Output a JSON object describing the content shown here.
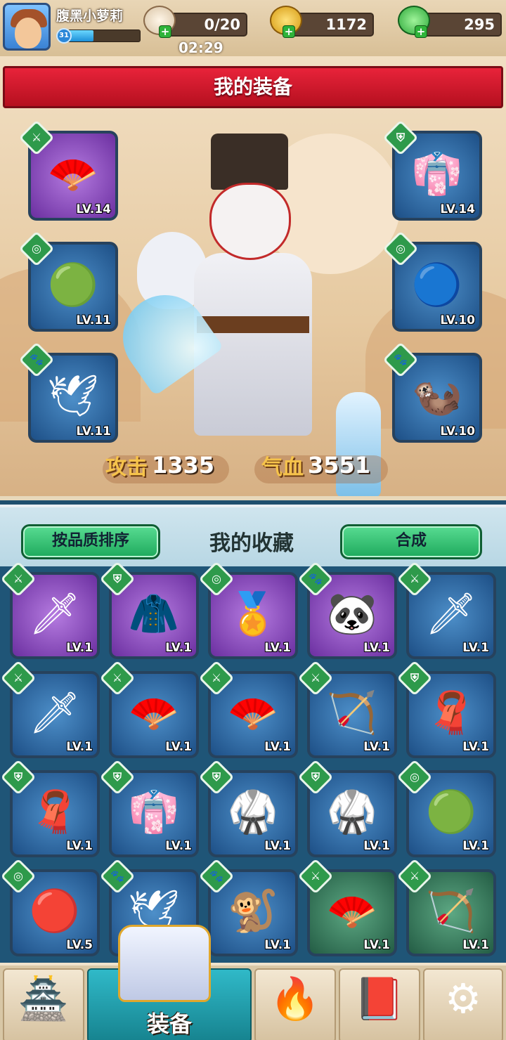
{
  "player": {
    "name": "腹黑小萝莉",
    "level": "31",
    "exp_fraction": 0.35
  },
  "resources": {
    "stamina": "0/20",
    "timer": "02:29",
    "gold": "1172",
    "jade": "295"
  },
  "equipment": {
    "title": "我的装备",
    "slots": [
      {
        "type": "weapon",
        "item": "fan",
        "level": "LV.14"
      },
      {
        "type": "armor",
        "item": "robe",
        "level": "LV.14"
      },
      {
        "type": "accessory",
        "item": "green-jade",
        "level": "LV.11"
      },
      {
        "type": "accessory",
        "item": "blue-jade",
        "level": "LV.10"
      },
      {
        "type": "pet",
        "item": "white-bird",
        "level": "LV.11"
      },
      {
        "type": "pet",
        "item": "ferret",
        "level": "LV.10"
      }
    ],
    "attack_label": "攻击",
    "attack_value": "1335",
    "hp_label": "气血",
    "hp_value": "3551"
  },
  "collection": {
    "sort_button": "按品质排序",
    "title": "我的收藏",
    "merge_button": "合成",
    "items": [
      {
        "type": "weapon",
        "rarity": "purple",
        "icon": "red-sword",
        "level": "LV.1"
      },
      {
        "type": "armor",
        "rarity": "purple",
        "icon": "fur-coat",
        "level": "LV.1"
      },
      {
        "type": "accessory",
        "rarity": "purple",
        "icon": "gold-pendant",
        "level": "LV.1"
      },
      {
        "type": "pet",
        "rarity": "purple",
        "icon": "panda",
        "level": "LV.1"
      },
      {
        "type": "weapon",
        "rarity": "blue",
        "icon": "jade-sword",
        "level": "LV.1"
      },
      {
        "type": "weapon",
        "rarity": "blue",
        "icon": "jade-sword",
        "level": "LV.1"
      },
      {
        "type": "weapon",
        "rarity": "blue",
        "icon": "blue-fan",
        "level": "LV.1"
      },
      {
        "type": "weapon",
        "rarity": "blue",
        "icon": "blue-fan",
        "level": "LV.1"
      },
      {
        "type": "weapon",
        "rarity": "blue",
        "icon": "bow",
        "level": "LV.1"
      },
      {
        "type": "armor",
        "rarity": "blue",
        "icon": "orange-cape",
        "level": "LV.1"
      },
      {
        "type": "armor",
        "rarity": "blue",
        "icon": "orange-cape",
        "level": "LV.1"
      },
      {
        "type": "armor",
        "rarity": "blue",
        "icon": "robe",
        "level": "LV.1"
      },
      {
        "type": "armor",
        "rarity": "blue",
        "icon": "tunic",
        "level": "LV.1"
      },
      {
        "type": "armor",
        "rarity": "blue",
        "icon": "tunic",
        "level": "LV.1"
      },
      {
        "type": "accessory",
        "rarity": "blue",
        "icon": "green-jade",
        "level": "LV.1"
      },
      {
        "type": "accessory",
        "rarity": "blue",
        "icon": "red-pendant",
        "level": "LV.5"
      },
      {
        "type": "pet",
        "rarity": "blue",
        "icon": "white-bird",
        "level": "LV.1"
      },
      {
        "type": "pet",
        "rarity": "blue",
        "icon": "monkey",
        "level": "LV.1"
      },
      {
        "type": "weapon",
        "rarity": "green",
        "icon": "paper-fan",
        "level": "LV.1"
      },
      {
        "type": "weapon",
        "rarity": "green",
        "icon": "crossbow",
        "level": "LV.1"
      }
    ]
  },
  "bottom_nav": {
    "active_label": "装备",
    "items": [
      "shop",
      "equipment",
      "skills",
      "codex",
      "settings"
    ]
  },
  "colors": {
    "banner_red": "#c8162a",
    "button_green": "#2ec46d",
    "rarity_purple": "#7a3cb0",
    "rarity_blue": "#24588f",
    "rarity_green": "#2d6b4e"
  }
}
